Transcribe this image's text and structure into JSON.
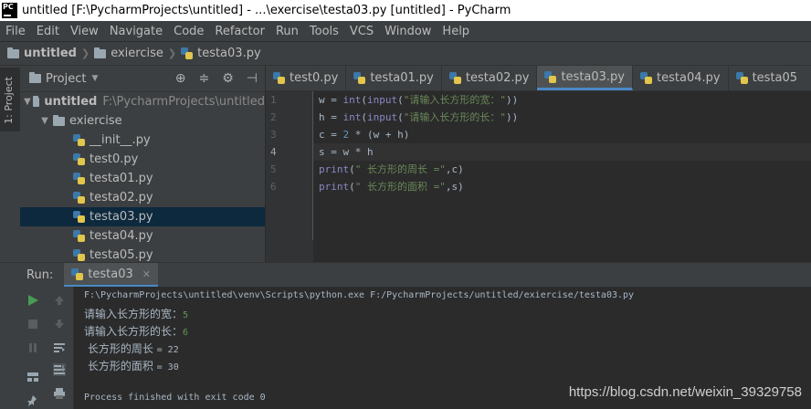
{
  "window": {
    "title": "untitled [F:\\PycharmProjects\\untitled] - ...\\exercise\\testa03.py [untitled] - PyCharm",
    "logo_text": "PC"
  },
  "menu": [
    "File",
    "Edit",
    "View",
    "Navigate",
    "Code",
    "Refactor",
    "Run",
    "Tools",
    "VCS",
    "Window",
    "Help"
  ],
  "breadcrumb": {
    "project": "untitled",
    "folder": "exiercise",
    "file": "testa03.py"
  },
  "side_tab": "1: Project",
  "project_panel": {
    "title": "Project",
    "root": {
      "name": "untitled",
      "path": "F:\\PycharmProjects\\untitled"
    },
    "folder": "exiercise",
    "files": [
      "__init__.py",
      "test0.py",
      "testa01.py",
      "testa02.py",
      "testa03.py",
      "testa04.py",
      "testa05.py"
    ],
    "selected": "testa03.py"
  },
  "editor": {
    "tabs": [
      "test0.py",
      "testa01.py",
      "testa02.py",
      "testa03.py",
      "testa04.py",
      "testa05"
    ],
    "active_tab": "testa03.py",
    "line_numbers": [
      "1",
      "2",
      "3",
      "4",
      "5",
      "6"
    ],
    "lines": [
      {
        "a": "w = ",
        "b": "int",
        "c": "(",
        "d": "input",
        "e": "(",
        "f": "\"请输入长方形的宽：\"",
        "g": "))"
      },
      {
        "a": "h = ",
        "b": "int",
        "c": "(",
        "d": "input",
        "e": "(",
        "f": "\"请输入长方形的长：\"",
        "g": "))"
      },
      {
        "a": "c = ",
        "n": "2",
        "g": " * (w + h)"
      },
      {
        "a": "s = w * h"
      },
      {
        "b": "print",
        "c": "(",
        "f": "\" 长方形的周长 =\"",
        "g": ",c)"
      },
      {
        "b": "print",
        "c": "(",
        "f": "\" 长方形的面积 =\"",
        "g": ",s)"
      }
    ]
  },
  "run": {
    "label": "Run:",
    "tab": "testa03",
    "output": {
      "cmd": "F:\\PycharmProjects\\untitled\\venv\\Scripts\\python.exe F:/PycharmProjects/untitled/exiercise/testa03.py",
      "prompt1": "请输入长方形的宽：",
      "input1": "5",
      "prompt2": "请输入长方形的长：",
      "input2": "6",
      "res1_label": " 长方形的周长 ",
      "res1_value": "= 22",
      "res2_label": " 长方形的面积 ",
      "res2_value": "= 30",
      "exit": "Process finished with exit code 0"
    }
  },
  "watermark": "https://blog.csdn.net/weixin_39329758",
  "colors": {
    "accent": "#4a88c7",
    "keyword": "#8888c6",
    "string": "#6a8759",
    "number": "#6897bb",
    "run_green": "#499c54"
  }
}
